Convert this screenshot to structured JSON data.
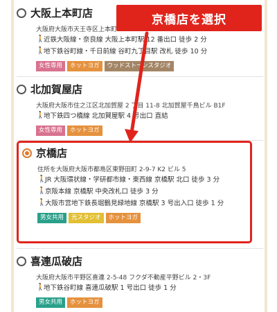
{
  "callout": {
    "text": "京橋店を選択"
  },
  "stores": [
    {
      "name": "大阪上本町店",
      "selected": false,
      "address": "大阪府大阪市天王寺区上本町",
      "access": [
        "近鉄大阪線・奈良線 大阪上本町駅 12 番出口 徒歩 2 分",
        "地下鉄谷町線・千日前線 谷町九丁目駅 改札 徒歩 10 分"
      ],
      "tags": [
        "女性専用",
        "ホットヨガ",
        "ウッドストーンスタジオ"
      ]
    },
    {
      "name": "北加賀屋店",
      "selected": false,
      "address": "大阪府大阪市住之江区北加賀屋 2 丁目 11-8 北加賀屋千鳥ビル B1F",
      "access": [
        "地下鉄四つ橋線 北加賀屋駅 4 号出口 直結"
      ],
      "tags": [
        "女性専用",
        "ホットヨガ"
      ]
    },
    {
      "name": "京橋店",
      "selected": true,
      "address": "住所を大阪府大阪市都島区東野田町 2-9-7 K2 ビル 5",
      "access": [
        "JR 大阪環状線・学研都市線・東西線 京橋駅 北口 徒歩 3 分",
        "京阪本線 京橋駅 中央改札口 徒歩 3 分",
        "大阪市営地下鉄長堀鶴見緑地線 京橋駅 3 号出入口 徒歩 1 分"
      ],
      "tags": [
        "男女共用",
        "光スタジオ",
        "ホットヨガ"
      ]
    },
    {
      "name": "喜連瓜破店",
      "selected": false,
      "address": "大阪府大阪市平野区喜連 2-5-48 フクダ不動産平野ビル 2・3F",
      "access": [
        "地下鉄谷町線 喜連瓜破駅 1 号出口 徒歩 1 分"
      ],
      "tags": [
        "男女共用",
        "ホットヨガ"
      ]
    }
  ],
  "colors": {
    "accent_red": "#e0241c",
    "radio_selected": "#e07a2e",
    "walk_icon": "#e39a2a"
  },
  "icons": {
    "walk": "walking-person-icon",
    "radio": "radio-button-icon",
    "arrow": "arrow-down-icon"
  }
}
